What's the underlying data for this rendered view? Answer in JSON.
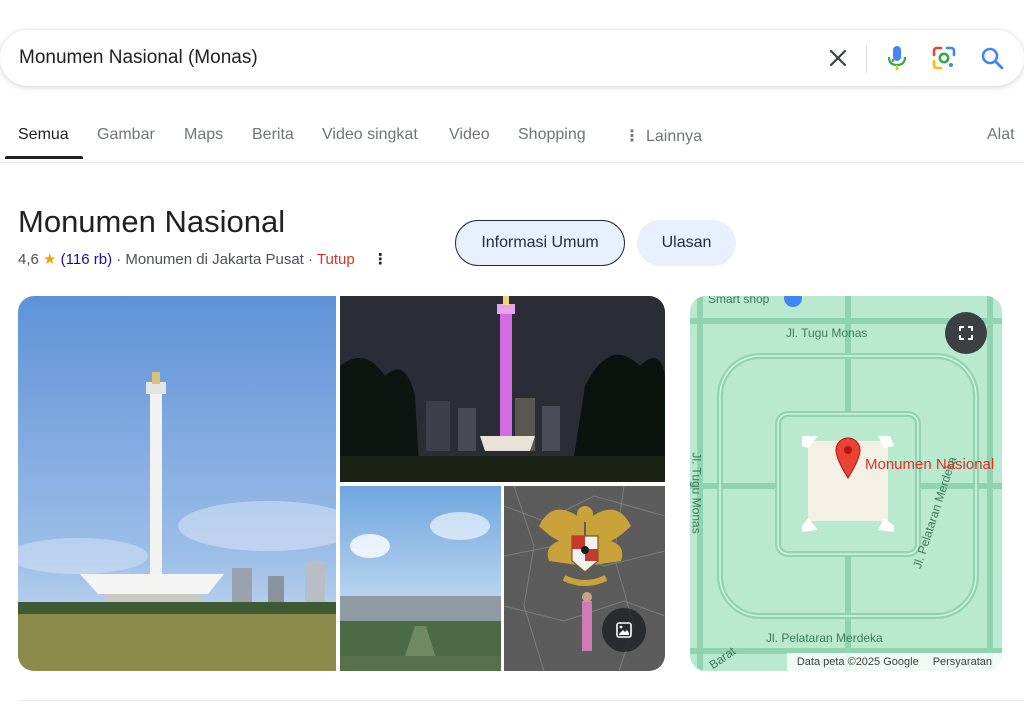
{
  "search": {
    "query": "Monumen Nasional (Monas)"
  },
  "tabs": {
    "items": [
      {
        "label": "Semua"
      },
      {
        "label": "Gambar"
      },
      {
        "label": "Maps"
      },
      {
        "label": "Berita"
      },
      {
        "label": "Video singkat"
      },
      {
        "label": "Video"
      },
      {
        "label": "Shopping"
      },
      {
        "label": "Lainnya"
      }
    ],
    "tools": "Alat"
  },
  "entity": {
    "title": "Monumen Nasional",
    "rating": "4,6",
    "review_count": "(116 rb)",
    "category": "· Monumen di Jakarta Pusat ·",
    "status": "Tutup",
    "chips": {
      "info": "Informasi Umum",
      "reviews": "Ulasan"
    }
  },
  "map": {
    "labels": {
      "shop": "Smart shop",
      "north_road": "Jl. Tugu Monas",
      "west_road": "Jl. Tugu Monas",
      "south_road": "Jl. Pelataran Merdeka",
      "east_road": "Jl. Pelataran Merdeka",
      "sw_road": "Barat"
    },
    "poi": "Monumen Nasional",
    "footer_data": "Data peta ©2025 Google",
    "footer_terms": "Persyaratan"
  },
  "colors": {
    "accent_blue": "#1a0dab",
    "closed_red": "#d93025",
    "star": "#f3a500",
    "map_green": "#b9ead0"
  }
}
